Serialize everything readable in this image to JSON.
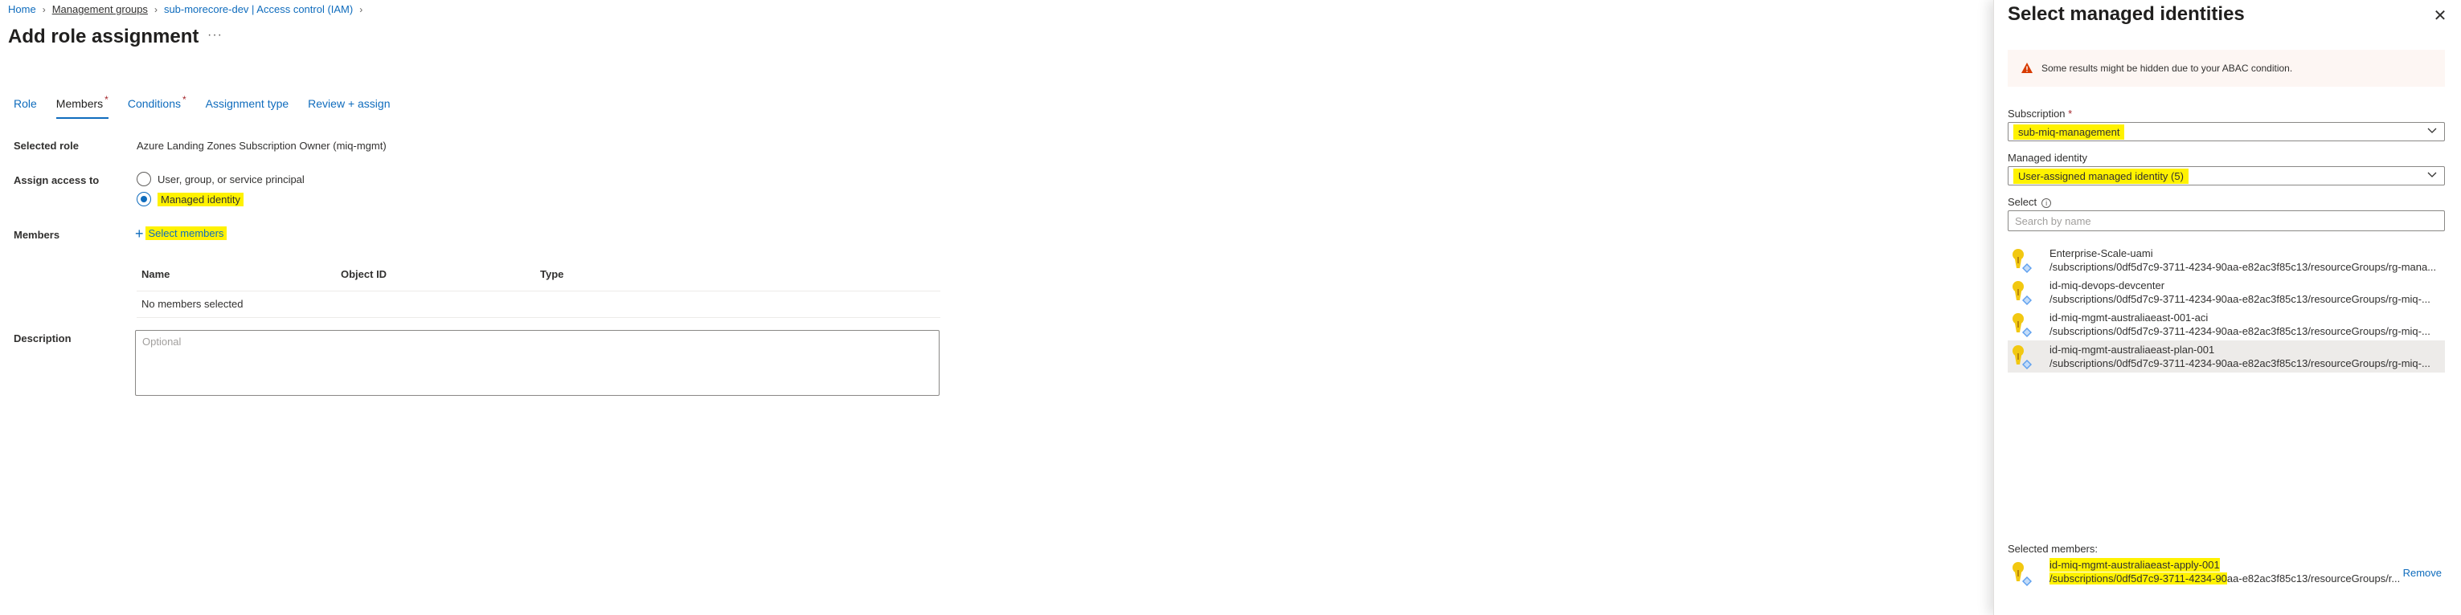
{
  "breadcrumb": [
    {
      "label": "Home",
      "style": "link"
    },
    {
      "label": "Management groups",
      "style": "underline"
    },
    {
      "label": "sub-morecore-dev | Access control (IAM)",
      "style": "link"
    }
  ],
  "page": {
    "title": "Add role assignment",
    "more": "···"
  },
  "tabs": [
    {
      "label": "Role",
      "required": false,
      "active": false
    },
    {
      "label": "Members",
      "required": true,
      "active": true
    },
    {
      "label": "Conditions",
      "required": true,
      "active": false
    },
    {
      "label": "Assignment type",
      "required": false,
      "active": false
    },
    {
      "label": "Review + assign",
      "required": false,
      "active": false
    }
  ],
  "form": {
    "selected_role_label": "Selected role",
    "selected_role_value": "Azure Landing Zones Subscription Owner (miq-mgmt)",
    "assign_access_label": "Assign access to",
    "option_user": "User, group, or service principal",
    "option_managed": "Managed identity",
    "assign_selected": "Managed identity",
    "members_label": "Members",
    "select_members": "Select members",
    "columns": [
      "Name",
      "Object ID",
      "Type"
    ],
    "empty_text": "No members selected",
    "description_label": "Description",
    "description_placeholder": "Optional"
  },
  "panel": {
    "title": "Select managed identities",
    "close": "✕",
    "warning": "Some results might be hidden due to your ABAC condition.",
    "subscription_label": "Subscription",
    "required_mark": "*",
    "subscription_value": "sub-miq-management",
    "managed_identity_label": "Managed identity",
    "managed_identity_value": "User-assigned managed identity (5)",
    "select_label": "Select",
    "search_placeholder": "Search by name",
    "identities": [
      {
        "name": "Enterprise-Scale-uami",
        "path": "/subscriptions/0df5d7c9-3711-4234-90aa-e82ac3f85c13/resourceGroups/rg-mana..."
      },
      {
        "name": "id-miq-devops-devcenter",
        "path": "/subscriptions/0df5d7c9-3711-4234-90aa-e82ac3f85c13/resourceGroups/rg-miq-..."
      },
      {
        "name": "id-miq-mgmt-australiaeast-001-aci",
        "path": "/subscriptions/0df5d7c9-3711-4234-90aa-e82ac3f85c13/resourceGroups/rg-miq-..."
      },
      {
        "name": "id-miq-mgmt-australiaeast-plan-001",
        "path": "/subscriptions/0df5d7c9-3711-4234-90aa-e82ac3f85c13/resourceGroups/rg-miq-..."
      }
    ],
    "selected_label": "Selected members:",
    "selected_member": {
      "name": "id-miq-mgmt-australiaeast-apply-001",
      "path_highlighted": "/subscriptions/0df5d7c9-3711-4234-90",
      "path_rest": "aa-e82ac3f85c13/resourceGroups/r..."
    },
    "remove": "Remove"
  },
  "colors": {
    "accent": "#0f6cbd",
    "highlight": "#fff200",
    "warning": "#d83b01",
    "identity_icon": "#f2c811"
  }
}
